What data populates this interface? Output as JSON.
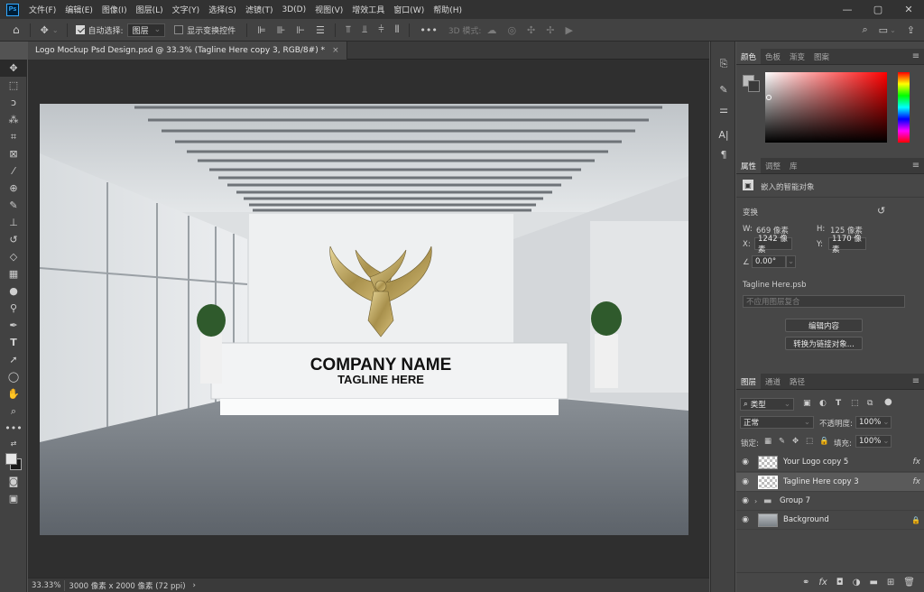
{
  "app": {
    "logo": "Ps"
  },
  "menu": [
    "文件(F)",
    "编辑(E)",
    "图像(I)",
    "图层(L)",
    "文字(Y)",
    "选择(S)",
    "滤镜(T)",
    "3D(D)",
    "视图(V)",
    "增效工具",
    "窗口(W)",
    "帮助(H)"
  ],
  "window_controls": {
    "minimize": "—",
    "maximize": "▢",
    "close": "✕"
  },
  "options": {
    "auto_select_label": "自动选择:",
    "auto_select_value": "图层",
    "show_transform_label": "显示变换控件",
    "mode_3d_label": "3D 模式:"
  },
  "document": {
    "tab_title": "Logo Mockup Psd Design.psd @ 33.3% (Tagline Here copy 3, RGB/8#) *",
    "tab_close": "×",
    "zoom": "33.33%",
    "dimensions": "3000 像素 x 2000 像素 (72 ppi)",
    "status_arrow": "›"
  },
  "mockup": {
    "company_name": "COMPANY NAME",
    "tagline": "TAGLINE HERE",
    "logo_gold": "#c8b46e"
  },
  "color_panel": {
    "tabs": [
      "颜色",
      "色板",
      "渐变",
      "图案"
    ]
  },
  "properties_panel": {
    "tabs": [
      "属性",
      "调整",
      "库"
    ],
    "type_label": "嵌入的智能对象",
    "transform_label": "变换",
    "w_label": "W:",
    "w_value": "669 像素",
    "h_label": "H:",
    "h_value": "125 像素",
    "x_label": "X:",
    "x_value": "1242 像素",
    "y_label": "Y:",
    "y_value": "1170 像素",
    "angle_value": "0.00°",
    "file_name": "Tagline Here.psb",
    "comp_placeholder": "不应用图层复合",
    "edit_button": "编辑内容",
    "convert_button": "转换为链接对象..."
  },
  "layers_panel": {
    "tabs": [
      "图层",
      "通道",
      "路径"
    ],
    "filter_label": "类型",
    "blend_mode": "正常",
    "opacity_label": "不透明度:",
    "opacity_value": "100%",
    "lock_label": "锁定:",
    "fill_label": "填充:",
    "fill_value": "100%",
    "layers": [
      {
        "name": "Your Logo copy 5",
        "fx": "fx"
      },
      {
        "name": "Tagline Here copy 3",
        "fx": "fx"
      },
      {
        "name": "Group 7",
        "fx": ""
      },
      {
        "name": "Background",
        "fx": ""
      }
    ],
    "lock_icon": "🔒"
  }
}
